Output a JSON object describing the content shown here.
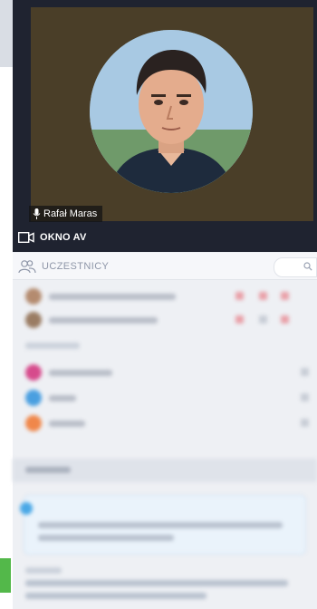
{
  "video": {
    "speaker_name": "Rafał Maras",
    "mic_icon": "microphone-icon"
  },
  "av_window": {
    "label": "OKNO AV",
    "icon": "camera-icon"
  },
  "participants": {
    "title": "UCZESTNICY",
    "icon": "people-icon",
    "search_icon": "search-icon"
  },
  "colors": {
    "video_bg": "#1f2330",
    "feed_bg": "#4a3e28",
    "accent_green": "#53b84a"
  }
}
